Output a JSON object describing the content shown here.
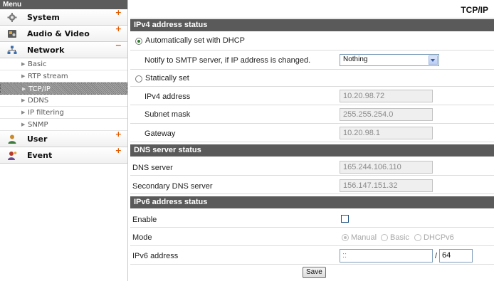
{
  "sidebar": {
    "header": "Menu",
    "items": [
      {
        "label": "System",
        "sign": "+",
        "icon": "gear-icon"
      },
      {
        "label": "Audio & Video",
        "sign": "+",
        "icon": "camera-icon"
      },
      {
        "label": "Network",
        "sign": "−",
        "icon": "network-icon"
      },
      {
        "label": "User",
        "sign": "+",
        "icon": "user-icon"
      },
      {
        "label": "Event",
        "sign": "+",
        "icon": "event-icon"
      }
    ],
    "network_sub": [
      "Basic",
      "RTP stream",
      "TCP/IP",
      "DDNS",
      "IP filtering",
      "SNMP"
    ],
    "active_sub": "TCP/IP",
    "arrow": "▶"
  },
  "page": {
    "title": "TCP/IP"
  },
  "ipv4": {
    "section": "IPv4 address status",
    "dhcp_label": "Automatically set with DHCP",
    "dhcp_selected": true,
    "notify_label": "Notify to SMTP server, if IP address is changed.",
    "notify_value": "Nothing",
    "static_label": "Statically set",
    "address_label": "IPv4 address",
    "address_value": "10.20.98.72",
    "mask_label": "Subnet mask",
    "mask_value": "255.255.254.0",
    "gateway_label": "Gateway",
    "gateway_value": "10.20.98.1"
  },
  "dns": {
    "section": "DNS server status",
    "primary_label": "DNS server",
    "primary_value": "165.244.106.110",
    "secondary_label": "Secondary DNS server",
    "secondary_value": "156.147.151.32"
  },
  "ipv6": {
    "section": "IPv6 address status",
    "enable_label": "Enable",
    "enable_checked": false,
    "mode_label": "Mode",
    "mode_options": [
      "Manual",
      "Basic",
      "DHCPv6"
    ],
    "mode_selected": "Manual",
    "address_label": "IPv6 address",
    "address_value": "::",
    "prefix_sep": "/",
    "prefix_value": "64"
  },
  "actions": {
    "save_label": "Save"
  },
  "colors": {
    "section_bar": "#5a5a5a",
    "accent_sign": "#e45a00",
    "radio_dot": "#2a7a2a"
  }
}
